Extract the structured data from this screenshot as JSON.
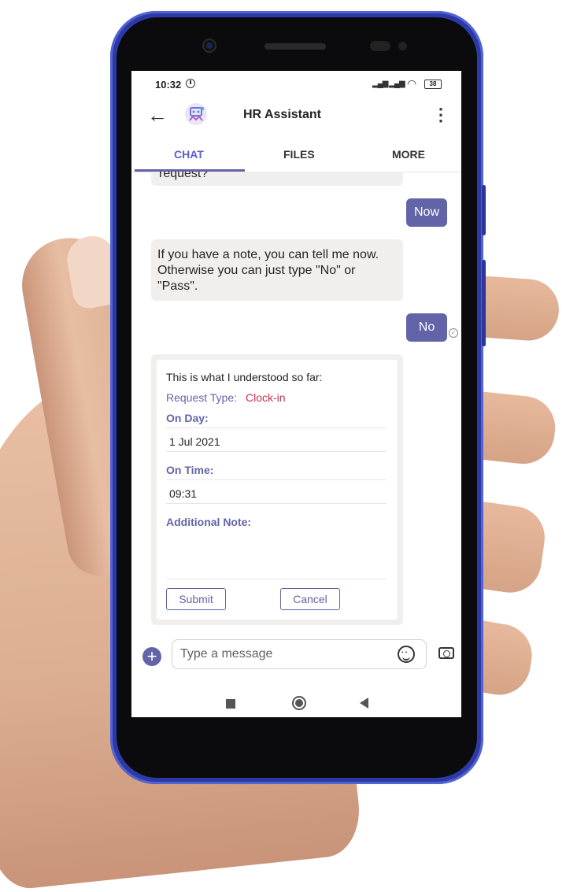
{
  "status_bar": {
    "time": "10:32",
    "battery": "38"
  },
  "header": {
    "title": "HR Assistant"
  },
  "tabs": [
    {
      "label": "CHAT"
    },
    {
      "label": "FILES"
    },
    {
      "label": "MORE"
    }
  ],
  "messages": {
    "clipped_text": "request?",
    "user_now": "Now",
    "bot_note": "If you have a note, you can tell me now. Otherwise you can just type \"No\" or \"Pass\".",
    "user_no": "No"
  },
  "card": {
    "header": "This is what I understood so far:",
    "request_type_label": "Request Type:",
    "request_type_value": "Clock-in",
    "on_day_label": "On Day:",
    "on_day_value": "1 Jul 2021",
    "on_time_label": "On Time:",
    "on_time_value": "09:31",
    "note_label": "Additional Note:",
    "note_value": "",
    "submit_label": "Submit",
    "cancel_label": "Cancel"
  },
  "composer": {
    "placeholder": "Type a message"
  },
  "icons": {
    "back": "arrow-left-icon",
    "avatar": "bot-avatar-icon",
    "more": "kebab-icon",
    "plus": "plus-icon",
    "emoji": "emoji-icon",
    "camera": "camera-icon"
  },
  "colors": {
    "accent": "#6264a7",
    "frame": "#2d3aa5",
    "request_value": "#c4314b"
  }
}
